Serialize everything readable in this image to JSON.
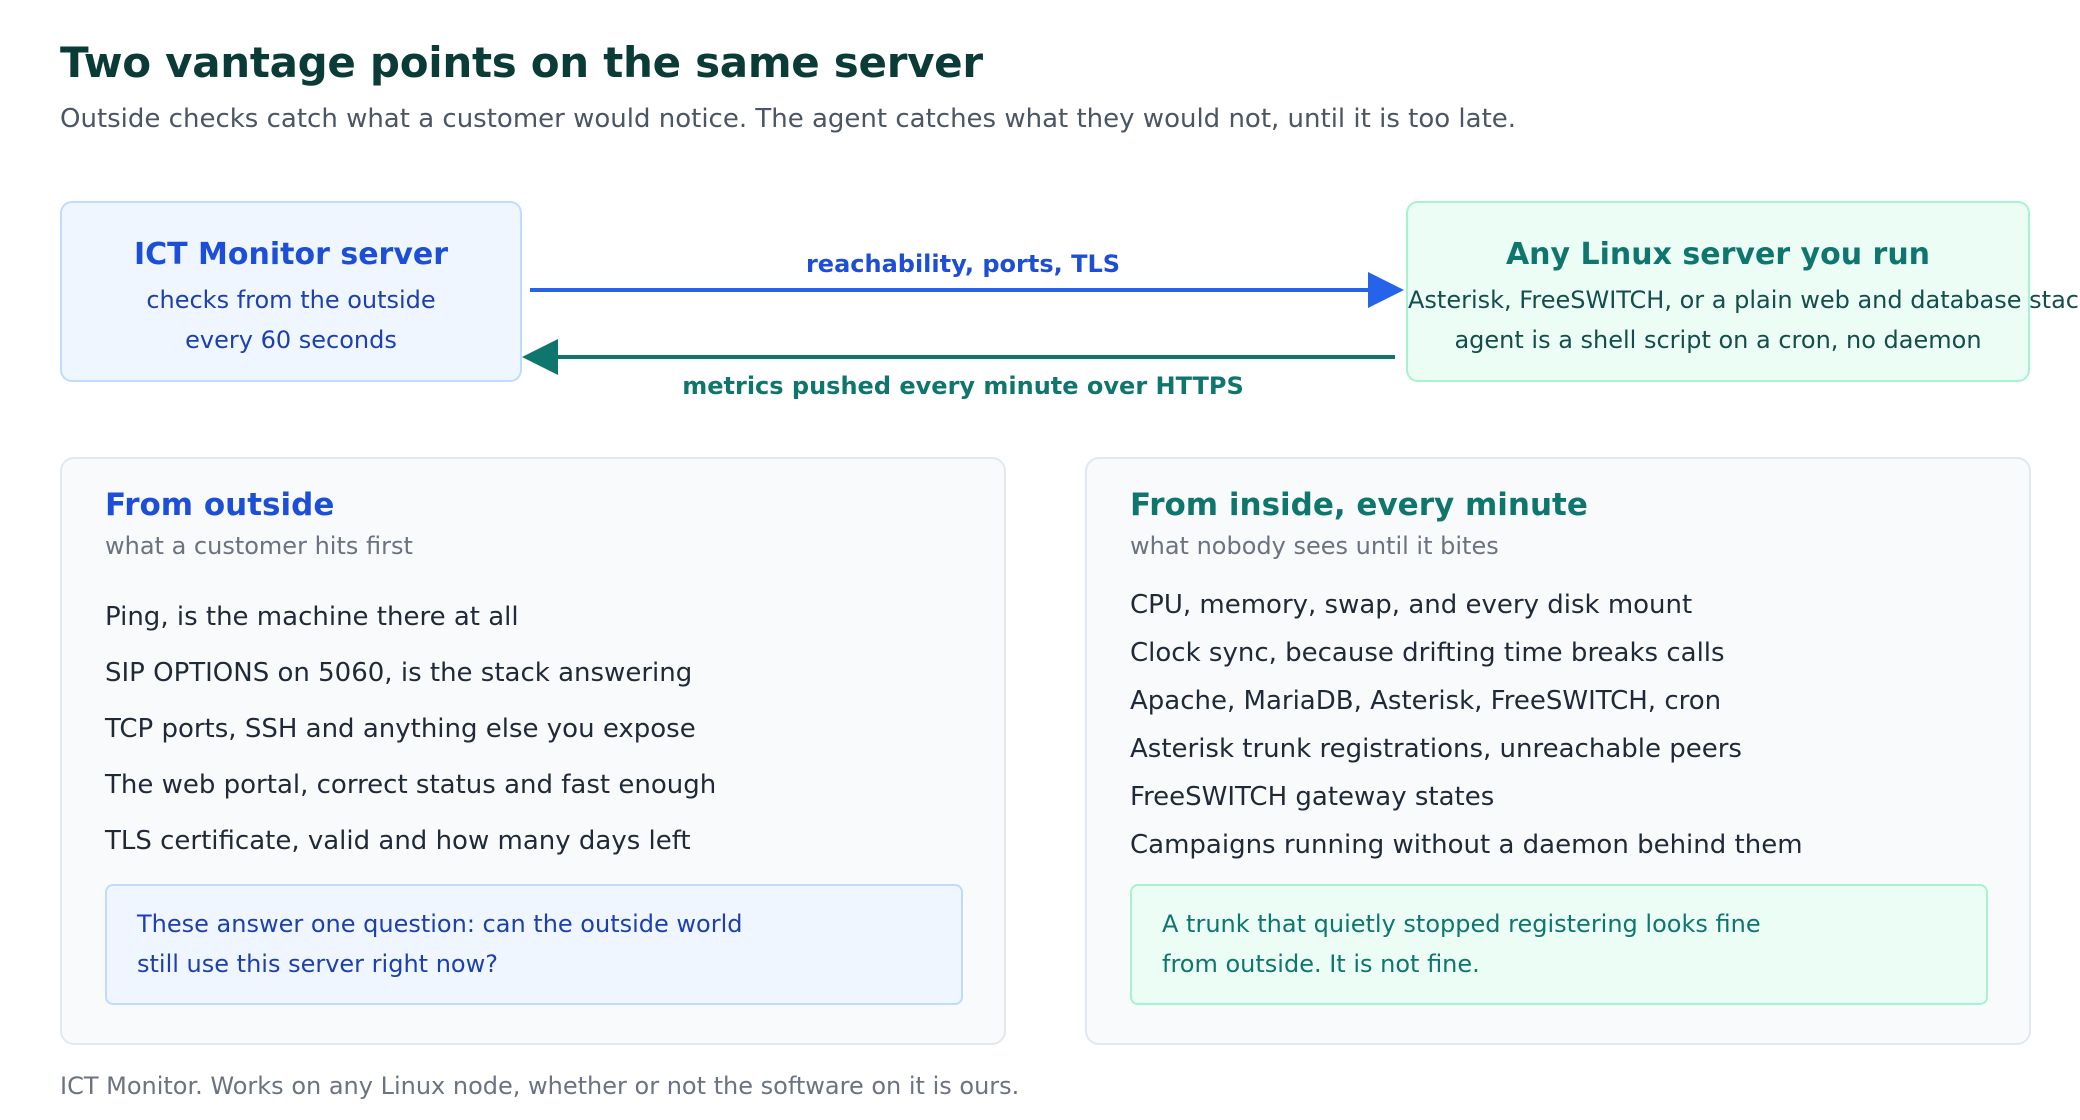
{
  "header": {
    "title": "Two vantage points on the same server",
    "subtitle": "Outside checks catch what a customer would notice. The agent catches what they would not, until it is too late."
  },
  "diagram": {
    "monitor_box": {
      "title": "ICT Monitor server",
      "lines": [
        "checks from the outside",
        "every 60 seconds"
      ]
    },
    "server_box": {
      "title": "Any Linux server you run",
      "lines": [
        "Asterisk, FreeSWITCH, or a plain web and database stack",
        "agent is a shell script on a cron, no daemon"
      ]
    },
    "arrow_outbound_label": "reachability, ports, TLS",
    "arrow_inbound_label": "metrics pushed every minute over HTTPS"
  },
  "panels": {
    "outside": {
      "heading": "From outside",
      "subheading": "what a customer hits first",
      "items": [
        "Ping, is the machine there at all",
        "SIP OPTIONS on 5060, is the stack answering",
        "TCP ports, SSH and anything else you expose",
        "The web portal, correct status and fast enough",
        "TLS certificate, valid and how many days left"
      ],
      "note_lines": [
        "These answer one question: can the outside world",
        "still use this server right now?"
      ]
    },
    "inside": {
      "heading": "From inside, every minute",
      "subheading": "what nobody sees until it bites",
      "items": [
        "CPU, memory, swap, and every disk mount",
        "Clock sync, because drifting time breaks calls",
        "Apache, MariaDB, Asterisk, FreeSWITCH, cron",
        "Asterisk trunk registrations, unreachable peers",
        "FreeSWITCH gateway states",
        "Campaigns running without a daemon behind them"
      ],
      "note_lines": [
        "A trunk that quietly stopped registering looks fine",
        "from outside. It is not fine."
      ]
    }
  },
  "footer": {
    "text": "ICT Monitor. Works on any Linux node, whether or not the software on it is ours."
  },
  "colors": {
    "outbound_arrow": "#2563eb",
    "inbound_arrow": "#0f766e"
  }
}
